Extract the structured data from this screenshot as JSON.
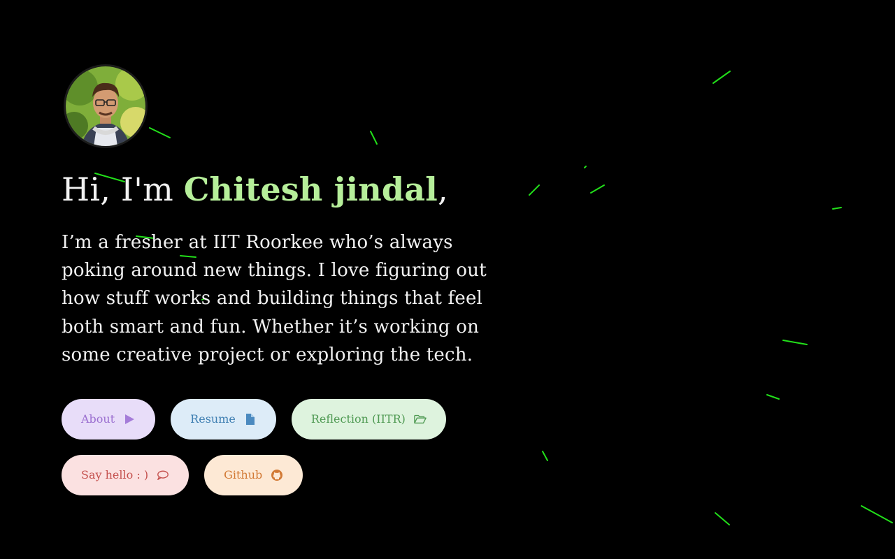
{
  "hero": {
    "greeting": "Hi, I'm ",
    "name": "Chitesh jindal",
    "comma": ",",
    "bio": "I’m a fresher at IIT Roorkee who’s always poking around new things. I love figuring out how stuff works and building things that feel both smart and fun. Whether it’s working on some creative project or exploring the tech."
  },
  "buttons": [
    {
      "label": "About",
      "icon": "play-icon"
    },
    {
      "label": "Resume",
      "icon": "document-icon"
    },
    {
      "label": "Reflection (IITR)",
      "icon": "folder-open-icon"
    },
    {
      "label": "Say hello : )",
      "icon": "chat-bubble-icon"
    },
    {
      "label": "Github",
      "icon": "github-icon"
    }
  ],
  "colors": {
    "background": "#000000",
    "name_accent": "#b6ef9a",
    "streak": "#22e01a"
  }
}
